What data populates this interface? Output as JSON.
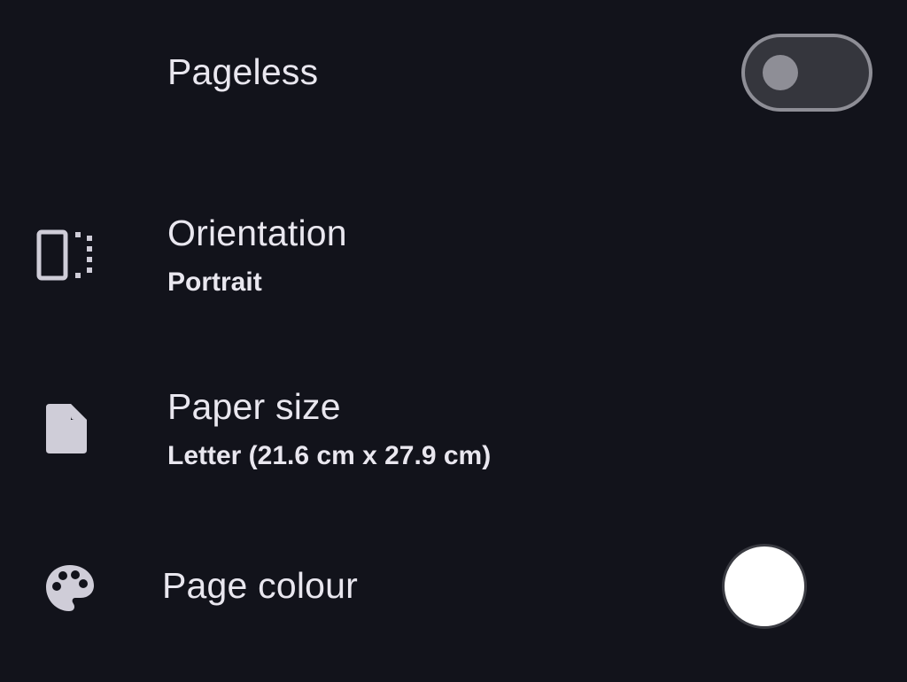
{
  "settings": {
    "pageless": {
      "label": "Pageless",
      "enabled": false
    },
    "orientation": {
      "label": "Orientation",
      "value": "Portrait",
      "icon": "orientation-icon"
    },
    "paper_size": {
      "label": "Paper size",
      "value": "Letter (21.6 cm x 27.9 cm)",
      "icon": "document-icon"
    },
    "page_colour": {
      "label": "Page colour",
      "color": "#ffffff",
      "icon": "palette-icon"
    }
  },
  "colors": {
    "background": "#12131b",
    "text": "#e9e7ef",
    "icon": "#cfcdd8",
    "toggle_off": "#8e8e96"
  }
}
